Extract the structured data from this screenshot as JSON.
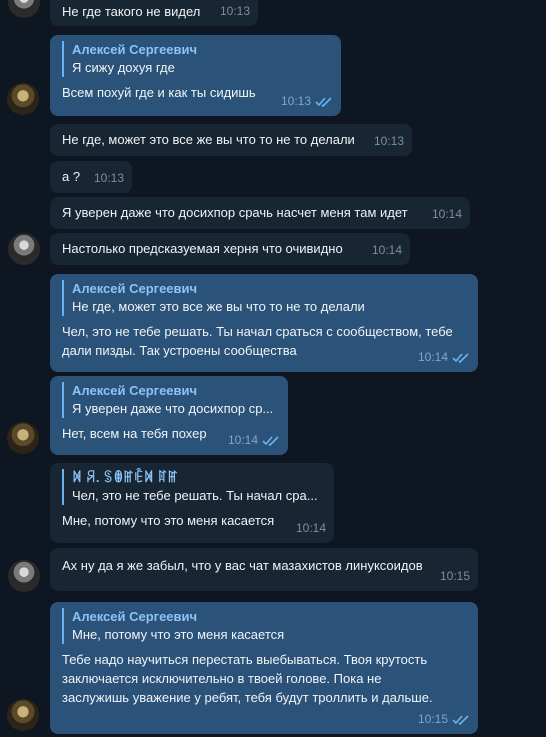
{
  "messages": [
    {
      "text": "Не где такого не видел",
      "time": "10:13"
    },
    {
      "reply_name": "Алексей Сергеевич",
      "reply_text": "Я сижу дохуя где",
      "text": "Всем похуй где и как ты сидишь",
      "time": "10:13"
    },
    {
      "text": "Не где, может это все же вы что то не то делали",
      "time": "10:13"
    },
    {
      "text": "а ?",
      "time": "10:13"
    },
    {
      "text": "Я уверен даже что досихпор срачь насчет меня там идет",
      "time": "10:14"
    },
    {
      "text": "Настолько предсказуемая херня что очивидно",
      "time": "10:14"
    },
    {
      "reply_name": "Алексей Сергеевич",
      "reply_text": "Не где, может это все же вы что то не то делали",
      "text": "Чел, это не тебе решать. Ты начал сраться с сообществом, тебе\nдали пизды. Так устроены сообщества",
      "time": "10:14"
    },
    {
      "reply_name": "Алексей Сергеевич",
      "reply_text": "Я уверен даже что досихпор ср...",
      "text": "Нет, всем на тебя похер",
      "time": "10:14"
    },
    {
      "reply_name": "ꁒ ꋪ. ꌗꂦꂵꍟꁒ ꍏꂵ",
      "reply_text": "Чел, это не тебе решать. Ты начал сра...",
      "text": "Мне, потому что это меня касается",
      "time": "10:14"
    },
    {
      "text": "Ах ну да я же забыл, что у вас чат мазахистов линуксоидов",
      "time": "10:15"
    },
    {
      "reply_name": "Алексей Сергеевич",
      "reply_text": "Мне, потому что это меня касается",
      "text": "Тебе надо научиться перестать выебываться. Твоя крутость\nзаключается исключительно в твоей голове. Пока не\nзаслужишь уважение у ребят, тебя будут троллить и дальше.",
      "time": "10:15"
    }
  ]
}
